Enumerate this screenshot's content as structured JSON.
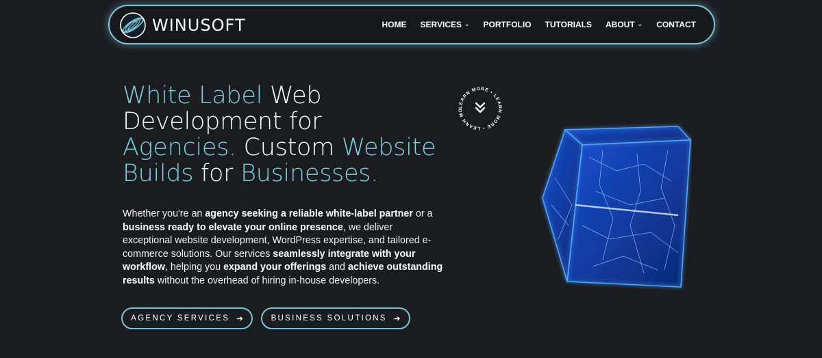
{
  "brand": {
    "name": "WINUSOFT"
  },
  "nav": {
    "items": [
      {
        "label": "HOME"
      },
      {
        "label": "SERVICES",
        "has_dropdown": true
      },
      {
        "label": "PORTFOLIO"
      },
      {
        "label": "TUTORIALS"
      },
      {
        "label": "ABOUT",
        "has_dropdown": true
      },
      {
        "label": "CONTACT"
      }
    ]
  },
  "hero": {
    "title": {
      "p1": "White Label",
      "p2": " Web",
      "p3": "Development for",
      "p4": "Agencies.",
      "p5": " Custom ",
      "p6": "Website",
      "p7": "Builds",
      "p8": " for ",
      "p9": "Businesses."
    },
    "body": {
      "t1": "Whether you're an ",
      "b1": "agency seeking a reliable white-label partner",
      "t2": " or a ",
      "b2": "business ready to elevate your online presence",
      "t3": ", we deliver exceptional website development, WordPress expertise, and tailored e-commerce solutions. Our services ",
      "b3": "seamlessly integrate with your workflow",
      "t4": ", helping you ",
      "b4": "expand your offerings",
      "t5": " and ",
      "b5": "achieve outstanding results",
      "t6": " without the overhead of hiring in-house developers."
    },
    "buttons": {
      "agency": "AGENCY SERVICES",
      "business": "BUSINESS SOLUTIONS",
      "arrow": "➔"
    },
    "learn_more": "LEARN MORE • LEARN MORE • LEARN MORE •"
  },
  "colors": {
    "accent": "#7ecfe0",
    "background": "#1a1c20",
    "cube": "#2f8cff"
  },
  "icons": {
    "logo": "spiral-globe-icon",
    "learn_more": "double-chevron-down-icon",
    "dropdown": "chevron-down-icon"
  }
}
